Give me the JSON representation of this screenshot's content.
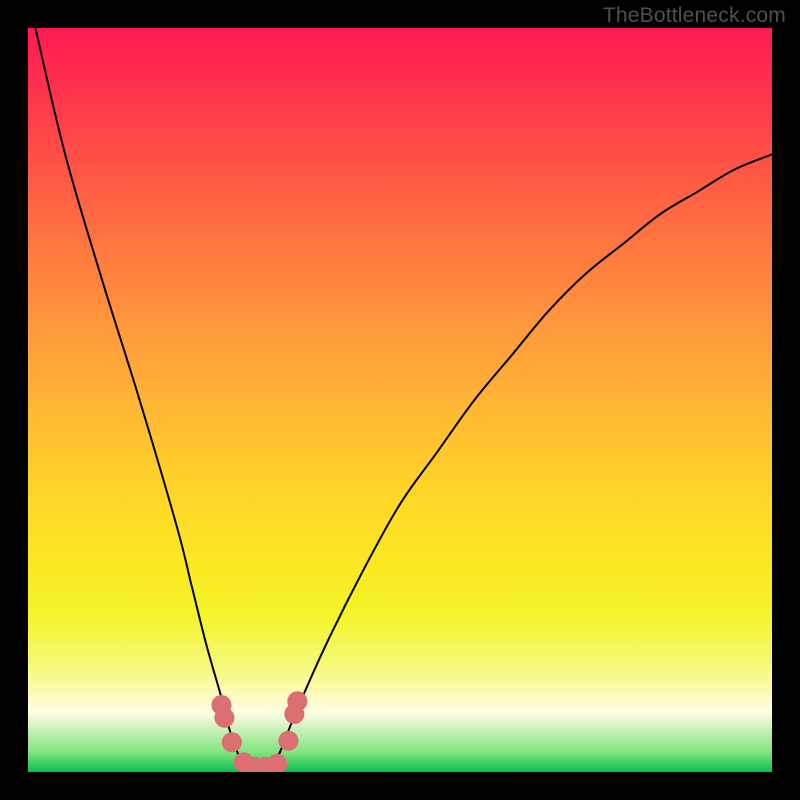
{
  "watermark": "TheBottleneck.com",
  "chart_data": {
    "type": "line",
    "title": "",
    "xlabel": "",
    "ylabel": "",
    "xlim": [
      0,
      100
    ],
    "ylim": [
      0,
      100
    ],
    "series": [
      {
        "name": "bottleneck-curve",
        "x": [
          1,
          5,
          10,
          15,
          20,
          22,
          24,
          26,
          27,
          28,
          29,
          30,
          32,
          33,
          34,
          36,
          40,
          45,
          50,
          55,
          60,
          65,
          70,
          75,
          80,
          85,
          90,
          95,
          100
        ],
        "y": [
          100,
          83,
          66,
          50,
          33,
          25,
          17,
          10,
          6,
          3,
          1,
          0,
          0,
          1,
          3,
          8,
          17,
          27,
          36,
          43,
          50,
          56,
          62,
          67,
          71,
          75,
          78,
          81,
          83
        ],
        "color": "#000000"
      }
    ],
    "markers": [
      {
        "name": "marker-left-upper",
        "x": 26.0,
        "y": 9.0,
        "r": 1.35,
        "color": "#db6f71"
      },
      {
        "name": "marker-left-mid",
        "x": 26.4,
        "y": 7.3,
        "r": 1.35,
        "color": "#db6f71"
      },
      {
        "name": "marker-left-lower",
        "x": 27.4,
        "y": 4.0,
        "r": 1.35,
        "color": "#db6f71"
      },
      {
        "name": "marker-bottom-a",
        "x": 29.0,
        "y": 1.3,
        "r": 1.35,
        "color": "#db6f71"
      },
      {
        "name": "marker-bottom-b",
        "x": 30.5,
        "y": 0.7,
        "r": 1.35,
        "color": "#db6f71"
      },
      {
        "name": "marker-bottom-c",
        "x": 32.0,
        "y": 0.7,
        "r": 1.35,
        "color": "#db6f71"
      },
      {
        "name": "marker-bottom-d",
        "x": 33.5,
        "y": 1.1,
        "r": 1.35,
        "color": "#db6f71"
      },
      {
        "name": "marker-right-lower",
        "x": 35.0,
        "y": 4.2,
        "r": 1.35,
        "color": "#db6f71"
      },
      {
        "name": "marker-right-mid",
        "x": 35.8,
        "y": 7.8,
        "r": 1.35,
        "color": "#db6f71"
      },
      {
        "name": "marker-right-upper",
        "x": 36.2,
        "y": 9.5,
        "r": 1.35,
        "color": "#db6f71"
      }
    ],
    "gradient_stops": [
      {
        "offset": 0,
        "color": "#ff1a52"
      },
      {
        "offset": 50,
        "color": "#ffc82f"
      },
      {
        "offset": 90,
        "color": "#fefde5"
      },
      {
        "offset": 100,
        "color": "#06c04f"
      }
    ]
  }
}
